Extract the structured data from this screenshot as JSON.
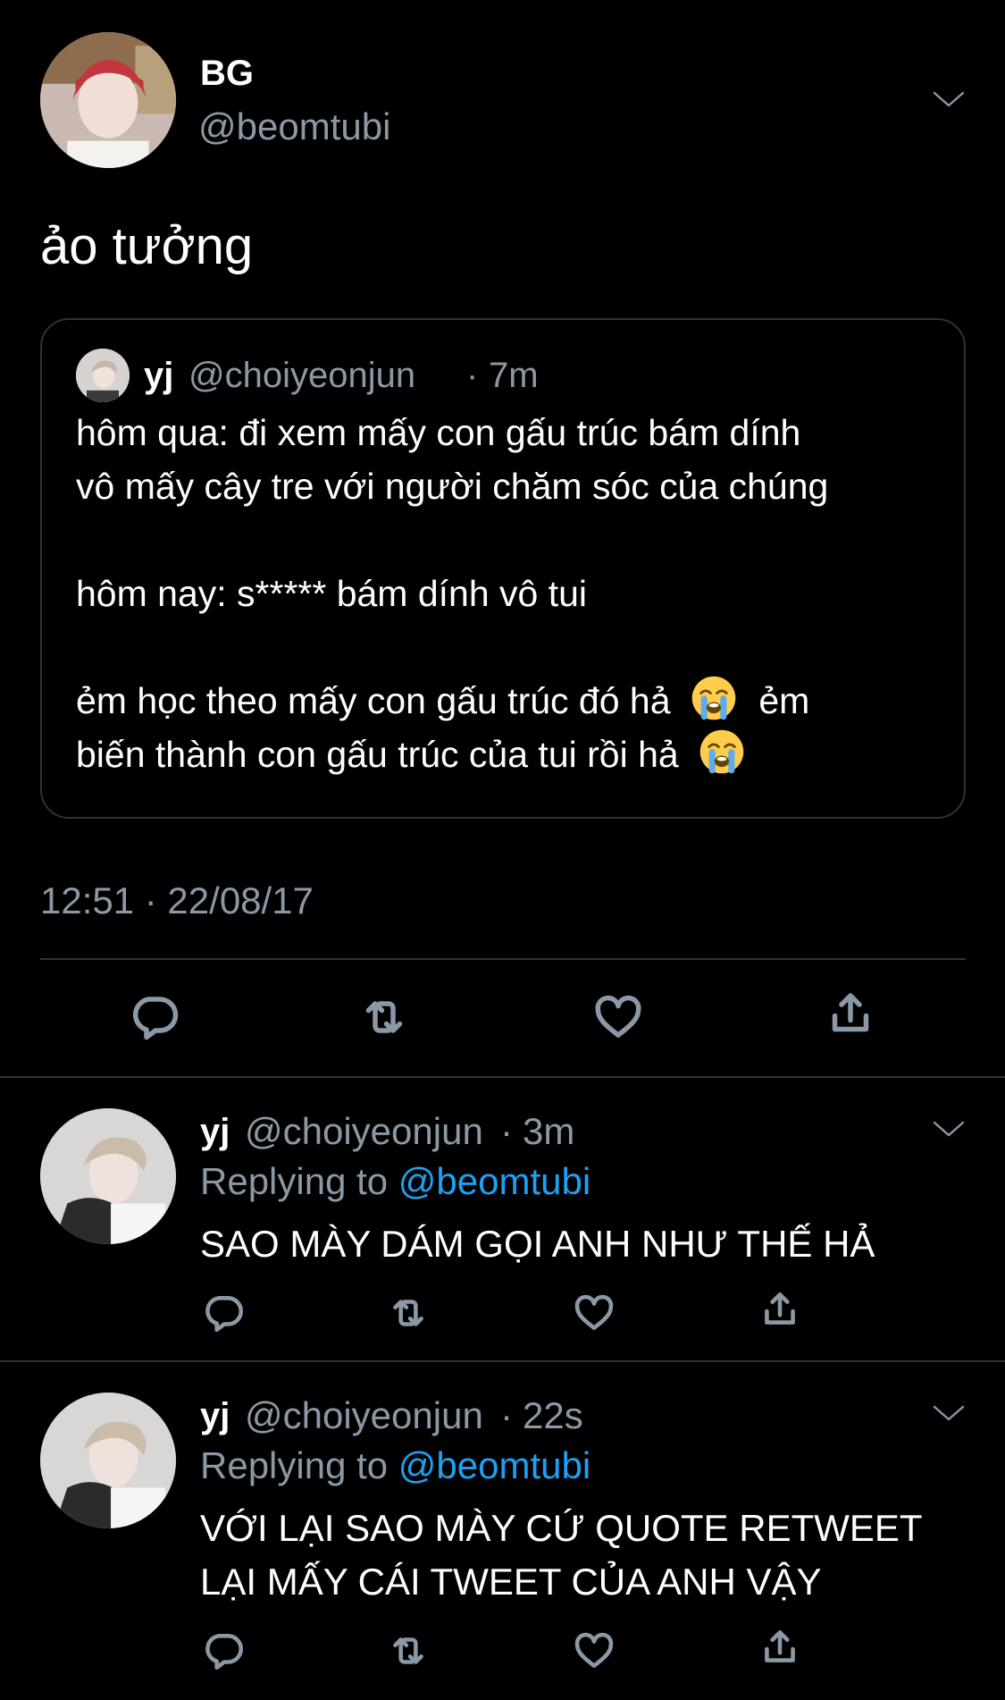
{
  "main_tweet": {
    "name": "BG",
    "handle": "@beomtubi",
    "text": "ảo tưởng",
    "timestamp": "12:51 · 22/08/17"
  },
  "quote": {
    "name": "yj",
    "handle": "@choiyeonjun",
    "separator": "·",
    "time": "7m",
    "lines": [
      "hôm qua: đi xem mấy con gấu trúc bám dính",
      "vô mấy cây tre với người chăm sóc của chúng",
      "hôm nay: s***** bám dính vô tui",
      "ẻm học theo mấy con gấu trúc đó hả",
      "ẻm",
      "biến thành con gấu trúc của tui rồi hả"
    ]
  },
  "replies": [
    {
      "name": "yj",
      "handle": "@choiyeonjun",
      "separator": "·",
      "time": "3m",
      "replying_to_label": "Replying to",
      "replying_to_handle": "@beomtubi",
      "lines": [
        "SAO MÀY DÁM GỌI ANH NHƯ THẾ HẢ"
      ]
    },
    {
      "name": "yj",
      "handle": "@choiyeonjun",
      "separator": "·",
      "time": "22s",
      "replying_to_label": "Replying to",
      "replying_to_handle": "@beomtubi",
      "lines": [
        "VỚI LẠI SAO MÀY CỨ QUOTE RETWEET",
        "LẠI MẤY CÁI TWEET CỦA ANH VẬY"
      ]
    }
  ],
  "icons": {
    "reply": "reply-icon",
    "retweet": "retweet-icon",
    "like": "heart-icon",
    "share": "share-icon",
    "more": "chevron-down-icon",
    "emoji": "loudly-crying-face-icon"
  },
  "colors": {
    "background": "#000000",
    "text": "#ffffff",
    "secondary": "#8b98a5",
    "link": "#1da1f2",
    "border": "#2f3336"
  }
}
